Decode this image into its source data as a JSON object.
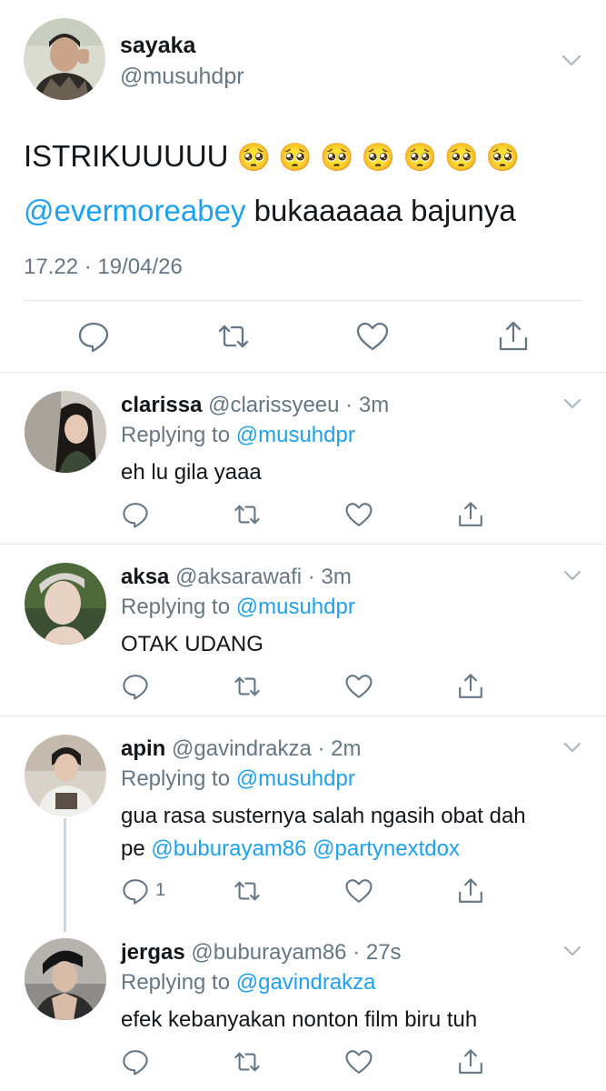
{
  "main_tweet": {
    "name": "sayaka",
    "handle": "@musuhdpr",
    "text": "ISTRIKUUUUU",
    "emojis": "🥺 🥺 🥺 🥺 🥺 🥺 🥺",
    "mention": "@evermoreabey",
    "text_after": " bukaaaaaa bajunya",
    "timestamp": "17.22 · 19/04/26",
    "icons": [
      "reply-icon",
      "retweet-icon",
      "like-icon",
      "share-icon"
    ]
  },
  "replies": [
    {
      "name": "clarissa",
      "handle": "@clarissyeeu",
      "time": "3m",
      "replying_label": "Replying to",
      "replying_to": "@musuhdpr",
      "text": "eh lu gila yaaa",
      "mentions": "",
      "reply_count": ""
    },
    {
      "name": "aksa",
      "handle": "@aksarawafi",
      "time": "3m",
      "replying_label": "Replying to",
      "replying_to": "@musuhdpr",
      "text": "OTAK UDANG",
      "mentions": "",
      "reply_count": ""
    },
    {
      "name": "apin",
      "handle": "@gavindrakza",
      "time": "2m",
      "replying_label": "Replying to",
      "replying_to": "@musuhdpr",
      "text": "gua rasa susternya salah ngasih obat dah",
      "text_line2_prefix": "pe ",
      "mentions": "@buburayam86 @partynextdox",
      "reply_count": "1"
    },
    {
      "name": "jergas",
      "handle": "@buburayam86",
      "time": "27s",
      "replying_label": "Replying to",
      "replying_to": "@gavindrakza",
      "text": "efek kebanyakan nonton film biru tuh",
      "mentions": "",
      "reply_count": ""
    }
  ],
  "sep": " · ",
  "colors": {
    "link": "#1da1f2",
    "muted": "#657786",
    "divider": "#e1e8ed",
    "thread_line": "#ccd6dd"
  }
}
